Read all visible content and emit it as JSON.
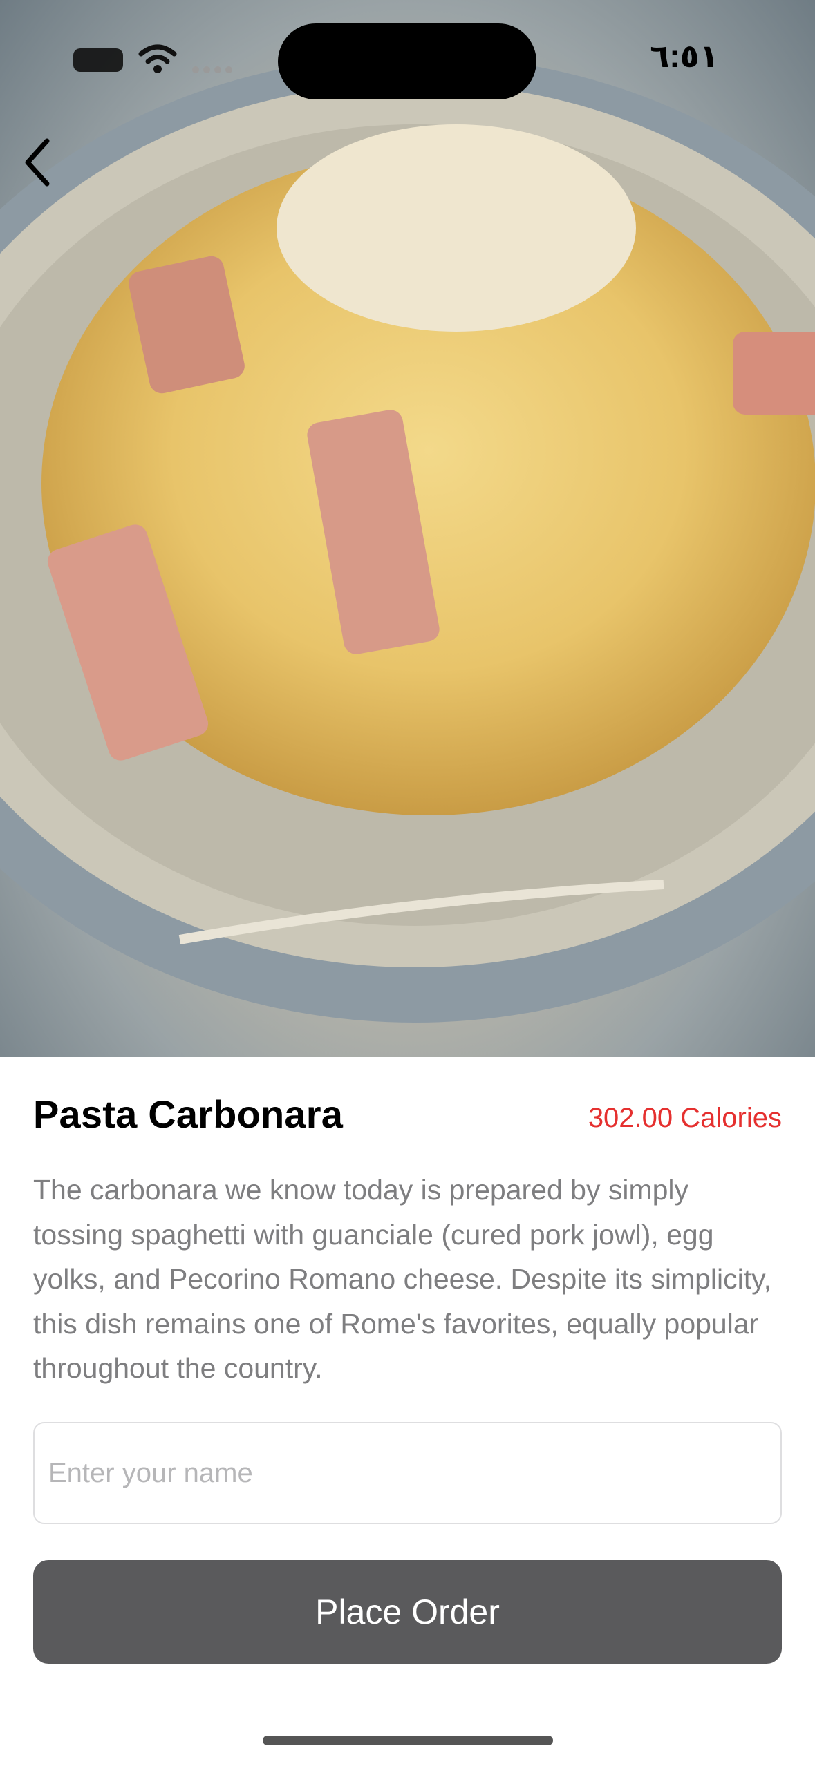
{
  "status_bar": {
    "time": "٦:٥١"
  },
  "dish": {
    "name": "Pasta Carbonara",
    "calories": "302.00 Calories",
    "description": "The carbonara we know today is prepared by simply tossing spaghetti with guanciale (cured pork jowl), egg yolks, and Pecorino Romano cheese. Despite its simplicity, this dish remains one of Rome's favorites, equally popular throughout the country."
  },
  "form": {
    "name_placeholder": "Enter your name",
    "name_value": "",
    "submit_label": "Place Order"
  },
  "colors": {
    "calories": "#e5302f",
    "button": "#5a5a5c",
    "description": "#7e7e80"
  },
  "icons": {
    "back": "chevron-left-icon",
    "wifi": "wifi-icon",
    "battery": "battery-icon",
    "signal": "signal-icon"
  }
}
